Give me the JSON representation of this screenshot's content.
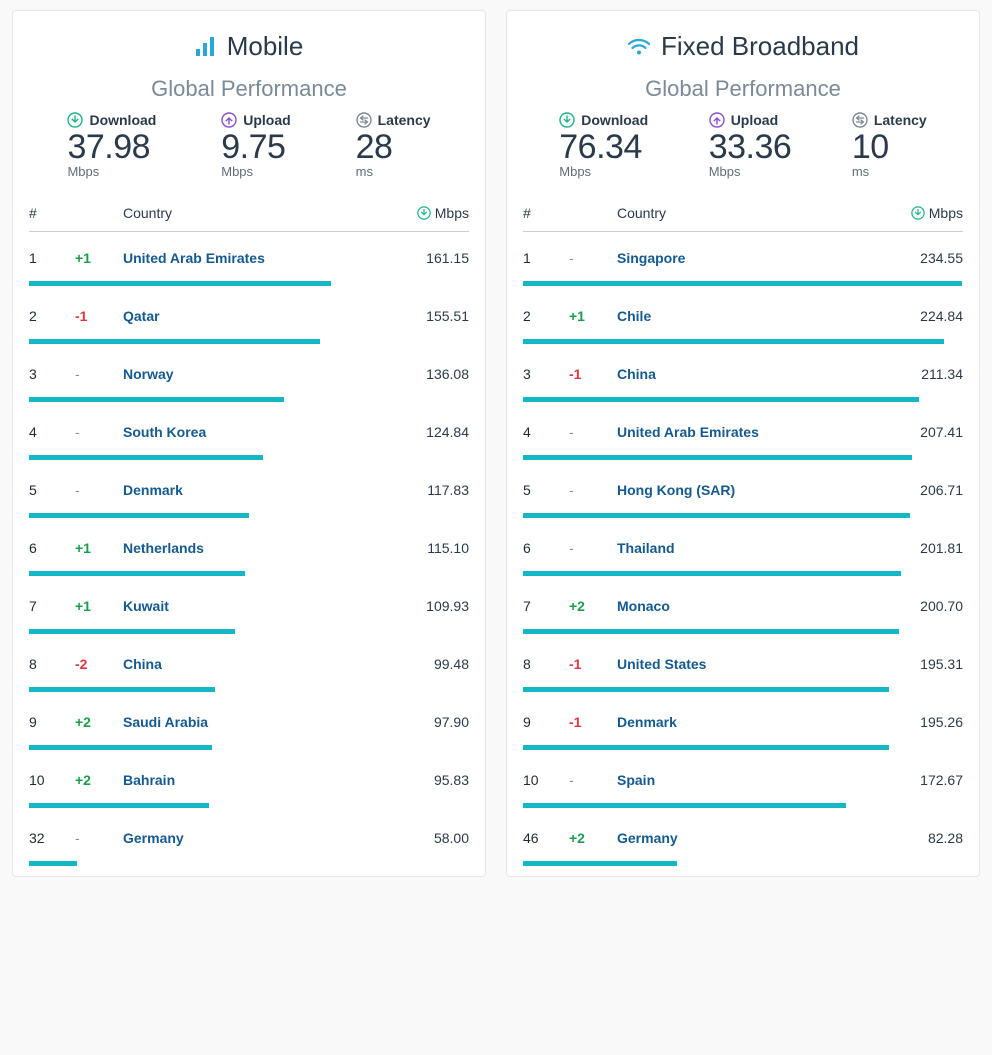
{
  "colors": {
    "bar": "#16b7c4",
    "download": "#1fb38a",
    "upload": "#8a4fc9",
    "latency": "#7a8a99",
    "delta_pos": "#1a9e4b",
    "delta_neg": "#e0363e",
    "link": "#145a91"
  },
  "chart_data": [
    {
      "type": "bar",
      "title": "Mobile — Global Performance (Download)",
      "xlabel": "Country",
      "ylabel": "Mbps",
      "ylim": [
        0,
        235
      ],
      "series": [
        {
          "name": "Download (Mbps)",
          "categories": [
            "United Arab Emirates",
            "Qatar",
            "Norway",
            "South Korea",
            "Denmark",
            "Netherlands",
            "Kuwait",
            "China",
            "Saudi Arabia",
            "Bahrain",
            "Germany"
          ],
          "values": [
            161.15,
            155.51,
            136.08,
            124.84,
            117.83,
            115.1,
            109.93,
            99.48,
            97.9,
            95.83,
            58.0
          ]
        }
      ]
    },
    {
      "type": "bar",
      "title": "Fixed Broadband — Global Performance (Download)",
      "xlabel": "Country",
      "ylabel": "Mbps",
      "ylim": [
        0,
        235
      ],
      "series": [
        {
          "name": "Download (Mbps)",
          "categories": [
            "Singapore",
            "Chile",
            "China",
            "United Arab Emirates",
            "Hong Kong (SAR)",
            "Thailand",
            "Monaco",
            "United States",
            "Denmark",
            "Spain",
            "Germany"
          ],
          "values": [
            234.55,
            224.84,
            211.34,
            207.41,
            206.71,
            201.81,
            200.7,
            195.31,
            195.26,
            172.67,
            82.28
          ]
        }
      ]
    }
  ],
  "labels": {
    "subtitle": "Global Performance",
    "download": "Download",
    "upload": "Upload",
    "latency": "Latency",
    "mbps": "Mbps",
    "ms": "ms",
    "rank": "#",
    "country": "Country"
  },
  "panels": [
    {
      "key": "mobile",
      "title": "Mobile",
      "icon": "signal-bars-icon",
      "metrics": {
        "download": "37.98",
        "upload": "9.75",
        "latency": "28"
      },
      "bar_max": 235,
      "rows": [
        {
          "rank": "1",
          "delta": "+1",
          "country": "United Arab Emirates",
          "mbps": "161.15",
          "pct": 68.6
        },
        {
          "rank": "2",
          "delta": "-1",
          "country": "Qatar",
          "mbps": "155.51",
          "pct": 66.2
        },
        {
          "rank": "3",
          "delta": "-",
          "country": "Norway",
          "mbps": "136.08",
          "pct": 57.9
        },
        {
          "rank": "4",
          "delta": "-",
          "country": "South Korea",
          "mbps": "124.84",
          "pct": 53.1
        },
        {
          "rank": "5",
          "delta": "-",
          "country": "Denmark",
          "mbps": "117.83",
          "pct": 50.1
        },
        {
          "rank": "6",
          "delta": "+1",
          "country": "Netherlands",
          "mbps": "115.10",
          "pct": 49.0
        },
        {
          "rank": "7",
          "delta": "+1",
          "country": "Kuwait",
          "mbps": "109.93",
          "pct": 46.8
        },
        {
          "rank": "8",
          "delta": "-2",
          "country": "China",
          "mbps": "99.48",
          "pct": 42.3
        },
        {
          "rank": "9",
          "delta": "+2",
          "country": "Saudi Arabia",
          "mbps": "97.90",
          "pct": 41.7
        },
        {
          "rank": "10",
          "delta": "+2",
          "country": "Bahrain",
          "mbps": "95.83",
          "pct": 40.8
        },
        {
          "rank": "32",
          "delta": "-",
          "country": "Germany",
          "mbps": "58.00",
          "pct": 11.0
        }
      ]
    },
    {
      "key": "fixed",
      "title": "Fixed Broadband",
      "icon": "wifi-icon",
      "metrics": {
        "download": "76.34",
        "upload": "33.36",
        "latency": "10"
      },
      "bar_max": 235,
      "rows": [
        {
          "rank": "1",
          "delta": "-",
          "country": "Singapore",
          "mbps": "234.55",
          "pct": 99.8
        },
        {
          "rank": "2",
          "delta": "+1",
          "country": "Chile",
          "mbps": "224.84",
          "pct": 95.7
        },
        {
          "rank": "3",
          "delta": "-1",
          "country": "China",
          "mbps": "211.34",
          "pct": 89.9
        },
        {
          "rank": "4",
          "delta": "-",
          "country": "United Arab Emirates",
          "mbps": "207.41",
          "pct": 88.3
        },
        {
          "rank": "5",
          "delta": "-",
          "country": "Hong Kong (SAR)",
          "mbps": "206.71",
          "pct": 88.0
        },
        {
          "rank": "6",
          "delta": "-",
          "country": "Thailand",
          "mbps": "201.81",
          "pct": 85.9
        },
        {
          "rank": "7",
          "delta": "+2",
          "country": "Monaco",
          "mbps": "200.70",
          "pct": 85.4
        },
        {
          "rank": "8",
          "delta": "-1",
          "country": "United States",
          "mbps": "195.31",
          "pct": 83.1
        },
        {
          "rank": "9",
          "delta": "-1",
          "country": "Denmark",
          "mbps": "195.26",
          "pct": 83.1
        },
        {
          "rank": "10",
          "delta": "-",
          "country": "Spain",
          "mbps": "172.67",
          "pct": 73.5
        },
        {
          "rank": "46",
          "delta": "+2",
          "country": "Germany",
          "mbps": "82.28",
          "pct": 35.0
        }
      ]
    }
  ]
}
